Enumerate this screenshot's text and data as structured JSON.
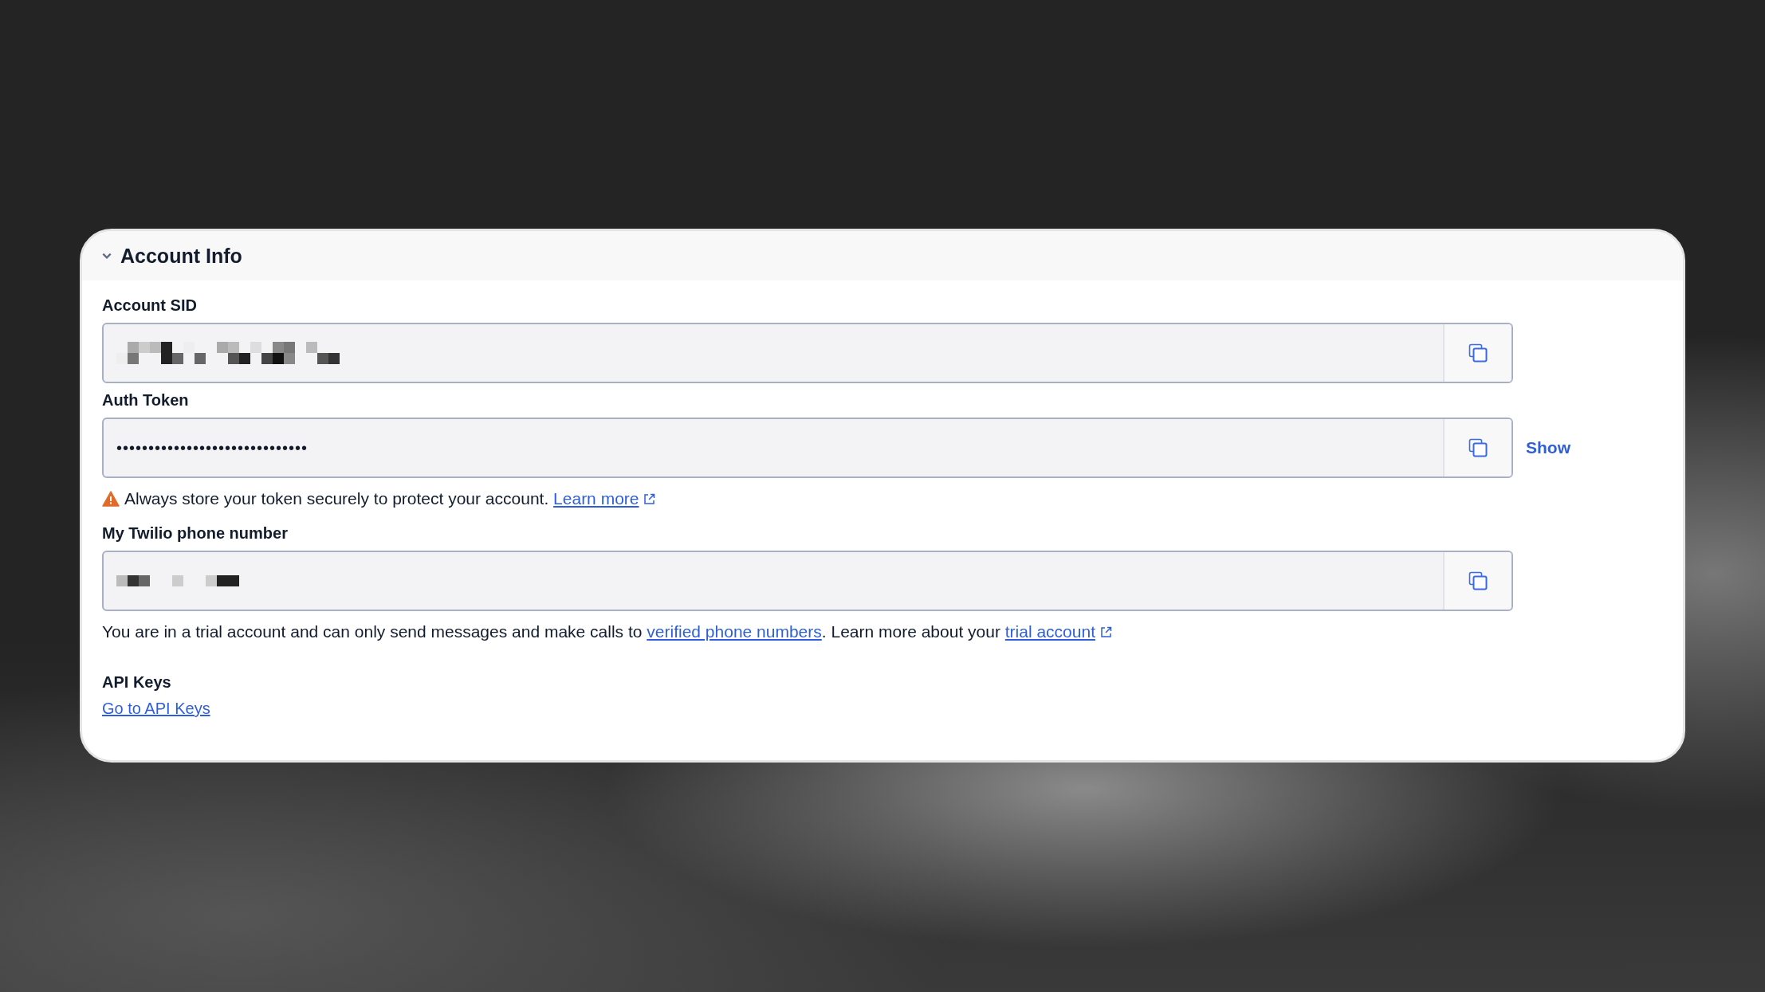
{
  "panel": {
    "title": "Account Info",
    "expanded": true
  },
  "fields": [
    {
      "label": "Account SID",
      "kind": "redacted"
    },
    {
      "label": "Auth Token",
      "kind": "text",
      "value": "••••••••••••••••••••••••••••••",
      "action": "Show",
      "notice": [
        {
          "kind": "warning"
        },
        {
          "kind": "text",
          "text": "Always store your token securely to protect your account. "
        },
        {
          "kind": "link",
          "text": "Learn more",
          "external": true
        }
      ]
    },
    {
      "label": "My Twilio phone number",
      "kind": "redacted_short",
      "notice": [
        {
          "kind": "text",
          "text": "You are in a trial account and can only send messages and make calls to "
        },
        {
          "kind": "link",
          "text": "verified phone numbers",
          "external": false
        },
        {
          "kind": "text",
          "text": ". Learn more about your "
        },
        {
          "kind": "link",
          "text": "trial account",
          "external": true
        }
      ]
    }
  ],
  "api_keys": {
    "heading": "API Keys",
    "link": "Go to API Keys"
  }
}
